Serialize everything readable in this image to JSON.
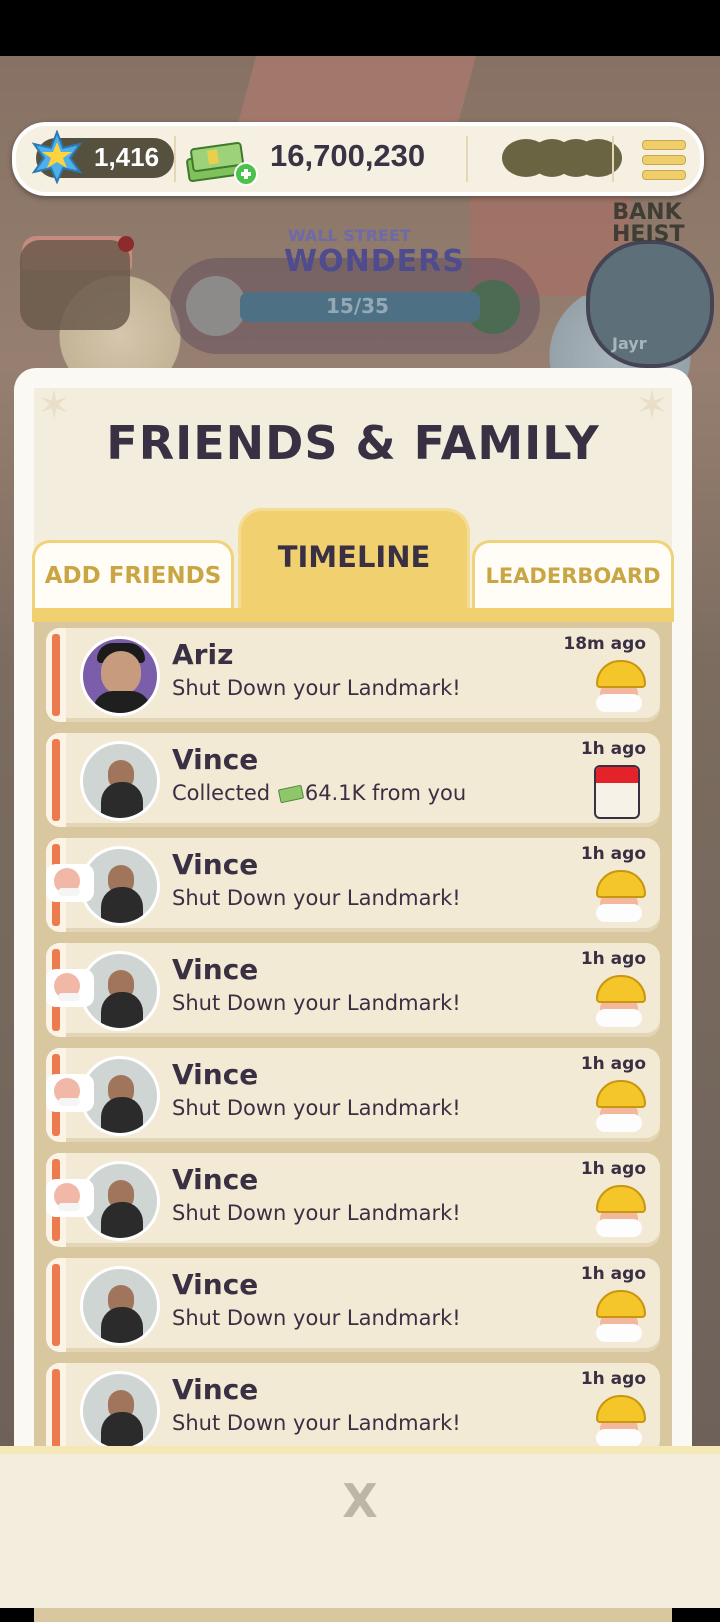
{
  "hud": {
    "stars": "1,416",
    "cash": "16,700,230"
  },
  "event": {
    "title": "WALL STREET",
    "name": "WONDERS",
    "progress_text": "15/35",
    "side_title": "BANK HEIST",
    "side_name": "Jayr"
  },
  "panel": {
    "title": "FRIENDS & FAMILY",
    "tabs": {
      "add": "ADD FRIENDS",
      "timeline": "TIMELINE",
      "leaderboard": "LEADERBOARD"
    }
  },
  "timeline": [
    {
      "name": "Ariz",
      "message": "Shut Down your Landmark!",
      "time": "18m ago",
      "icon": "builder-mascot-icon"
    },
    {
      "name": "Vince",
      "message_prefix": "Collected",
      "message_value": "64.1K from you",
      "time": "1h ago",
      "icon": "calendar-icon"
    },
    {
      "name": "Vince",
      "message": "Shut Down your Landmark!",
      "time": "1h ago",
      "icon": "builder-mascot-icon"
    },
    {
      "name": "Vince",
      "message": "Shut Down your Landmark!",
      "time": "1h ago",
      "icon": "builder-mascot-icon"
    },
    {
      "name": "Vince",
      "message": "Shut Down your Landmark!",
      "time": "1h ago",
      "icon": "builder-mascot-icon"
    },
    {
      "name": "Vince",
      "message": "Shut Down your Landmark!",
      "time": "1h ago",
      "icon": "builder-mascot-icon"
    },
    {
      "name": "Vince",
      "message": "Shut Down your Landmark!",
      "time": "1h ago",
      "icon": "builder-mascot-icon"
    },
    {
      "name": "Vince",
      "message": "Shut Down your Landmark!",
      "time": "1h ago",
      "icon": "builder-mascot-icon"
    }
  ],
  "footer": {
    "close": "X"
  },
  "colors": {
    "accent_orange": "#ec7b4f",
    "tab_gold": "#f1d06f",
    "text_dark": "#3a3043"
  }
}
